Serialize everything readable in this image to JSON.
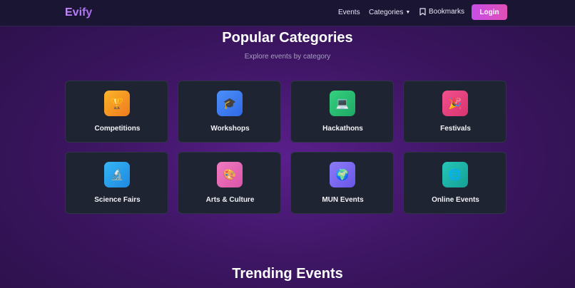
{
  "nav": {
    "logo": "Evify",
    "links": [
      "Events",
      "Categories",
      "Bookmarks"
    ],
    "login_label": "Login"
  },
  "categories_section": {
    "title": "Popular Categories",
    "subtitle": "Explore events by category",
    "items": [
      {
        "label": "Competitions",
        "icon": "trophy-icon",
        "glyph": "🏆",
        "color_from": "#f9b52a",
        "color_to": "#f07a1e"
      },
      {
        "label": "Workshops",
        "icon": "graduation-cap-icon",
        "glyph": "🎓",
        "color_from": "#4c8ff8",
        "color_to": "#2f6ae6"
      },
      {
        "label": "Hackathons",
        "icon": "laptop-icon",
        "glyph": "💻",
        "color_from": "#34d17f",
        "color_to": "#1fa864"
      },
      {
        "label": "Festivals",
        "icon": "party-popper-icon",
        "glyph": "🎉",
        "color_from": "#f2508e",
        "color_to": "#d8356f"
      },
      {
        "label": "Science Fairs",
        "icon": "microscope-icon",
        "glyph": "🔬",
        "color_from": "#36b6f4",
        "color_to": "#1e88e0"
      },
      {
        "label": "Arts & Culture",
        "icon": "palette-icon",
        "glyph": "🎨",
        "color_from": "#f27ac0",
        "color_to": "#d955a8"
      },
      {
        "label": "MUN Events",
        "icon": "globe-icon",
        "glyph": "🌍",
        "color_from": "#8b7cf6",
        "color_to": "#6a55e8"
      },
      {
        "label": "Online Events",
        "icon": "web-globe-icon",
        "glyph": "🌐",
        "color_from": "#25c7b8",
        "color_to": "#159f96"
      }
    ]
  },
  "trending_section": {
    "title": "Trending Events"
  }
}
